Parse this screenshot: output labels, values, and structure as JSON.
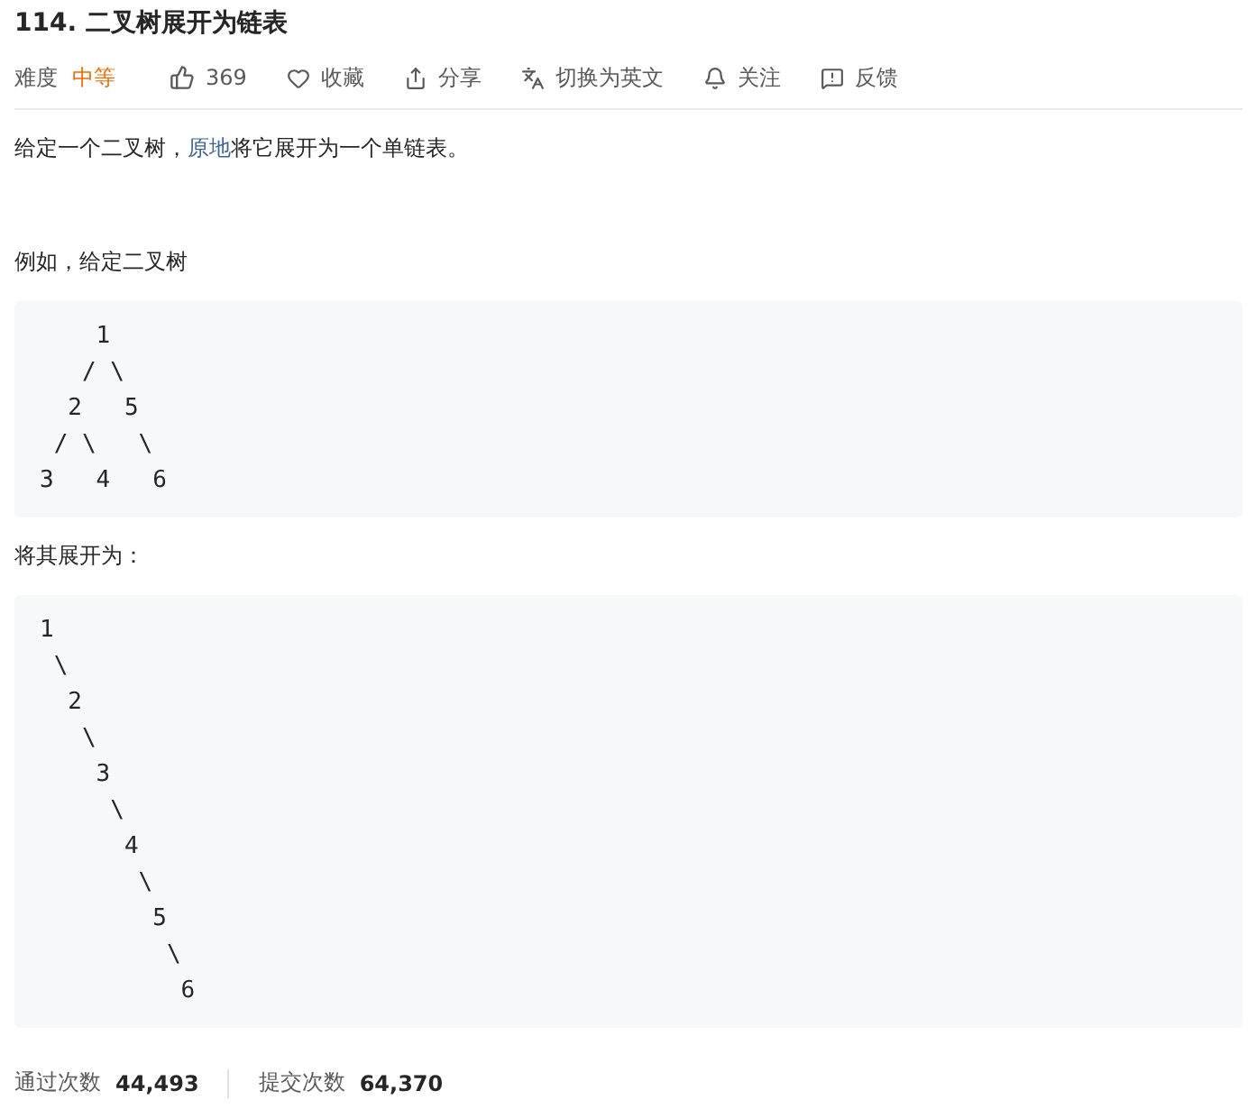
{
  "title": "114. 二叉树展开为链表",
  "meta": {
    "difficulty_label": "难度",
    "difficulty": "中等",
    "likes": "369",
    "actions": [
      {
        "kind": "favorite",
        "label": "收藏"
      },
      {
        "kind": "share",
        "label": "分享"
      },
      {
        "kind": "translate",
        "label": "切换为英文"
      },
      {
        "kind": "follow",
        "label": "关注"
      },
      {
        "kind": "feedback",
        "label": "反馈"
      }
    ]
  },
  "content": [
    {
      "kind": "text",
      "text": "给定一个二叉树，",
      "link": "原地",
      "after": "将它展开为一个单链表。"
    },
    {
      "kind": "spacer"
    },
    {
      "kind": "text",
      "text": "例如，给定二叉树"
    },
    {
      "kind": "code",
      "lines": [
        "    1",
        "   / \\",
        "  2   5",
        " / \\   \\",
        "3   4   6"
      ]
    },
    {
      "kind": "text",
      "text": "将其展开为："
    },
    {
      "kind": "code",
      "lines": [
        "1",
        " \\",
        "  2",
        "   \\",
        "    3",
        "     \\",
        "      4",
        "       \\",
        "        5",
        "         \\",
        "          6"
      ]
    }
  ],
  "stats": [
    {
      "label": "通过次数",
      "value": "44,493"
    },
    {
      "label": "提交次数",
      "value": "64,370"
    }
  ]
}
